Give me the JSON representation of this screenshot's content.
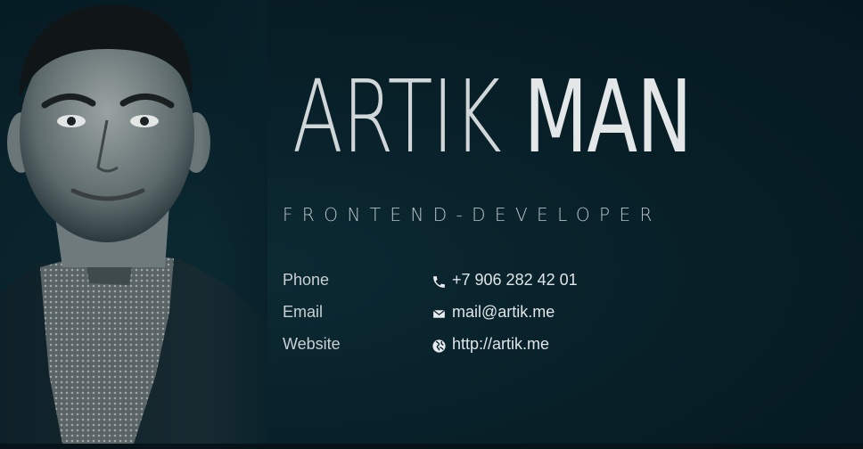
{
  "profile": {
    "first_name": "ARTIK",
    "last_name": "MAN",
    "role": "FRONTEND-DEVELOPER",
    "photo_alt": "portrait-photo"
  },
  "contacts": [
    {
      "label": "Phone",
      "value": "+7 906 282 42 01",
      "icon": "phone-icon"
    },
    {
      "label": "Email",
      "value": "mail@artik.me",
      "icon": "envelope-icon"
    },
    {
      "label": "Website",
      "value": "http://artik.me",
      "icon": "globe-icon"
    }
  ],
  "colors": {
    "background": "#082029",
    "text": "#e3e7e8",
    "muted": "#b9c2c5"
  }
}
